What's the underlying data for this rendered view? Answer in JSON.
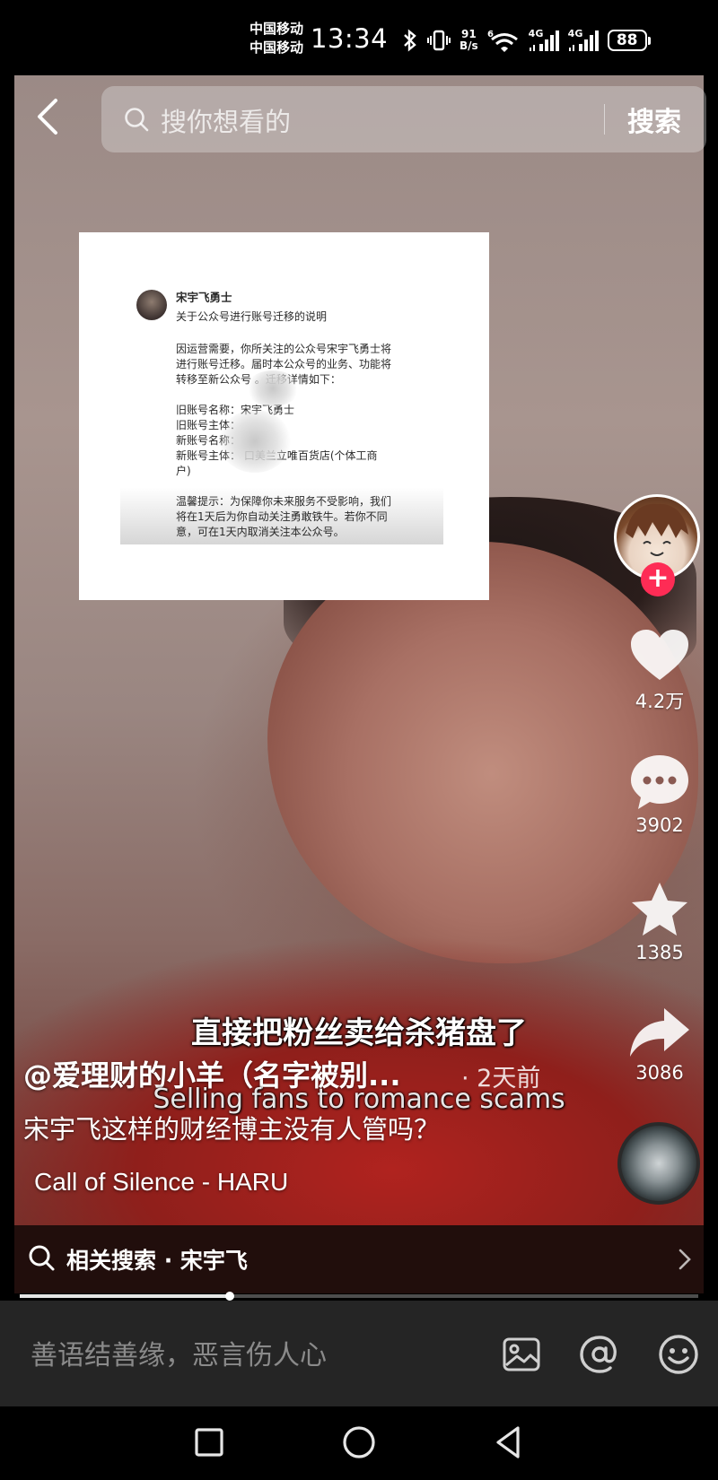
{
  "status_bar": {
    "carrier_1": "中国移动",
    "carrier_2": "中国移动",
    "time": "13:34",
    "net_speed_value": "91",
    "net_speed_unit": "B/s",
    "signal_1": "4G",
    "signal_2": "4G",
    "battery": "88"
  },
  "search": {
    "placeholder": "搜你想看的",
    "button_label": "搜索"
  },
  "document": {
    "account_name": "宋宇飞勇士",
    "title": "关于公众号进行账号迁移的说明",
    "body_lines": [
      "因运营需要，你所关注的公众号宋宇飞勇士将",
      "进行账号迁移。届时本公众号的业务、功能将",
      "转移至新公众号        。迁移详情如下：",
      "",
      "旧账号名称：宋宇飞勇士",
      "旧账号主体：",
      "新账号名称：",
      "新账号主体：    口美兰立唯百货店(个体工商",
      "户)",
      "",
      "温馨提示：为保障你未来服务不受影响，我们",
      "将在1天后为你自动关注勇敢铁牛。若你不同",
      "意，可在1天内取消关注本公众号。"
    ]
  },
  "rail": {
    "likes": "4.2万",
    "comments": "3902",
    "favorites": "1385",
    "shares": "3086"
  },
  "video": {
    "caption_cn": "直接把粉丝卖给杀猪盘了",
    "caption_en": "Selling fans to romance scams",
    "author": "@爱理财的小羊（名字被别...",
    "post_time": "· 2天前",
    "description": "宋宇飞这样的财经博主没有人管吗？",
    "music": "Call of Silence - HARU",
    "progress": 0.31
  },
  "related": {
    "label": "相关搜索 · 宋宇飞"
  },
  "comment": {
    "placeholder": "善语结善缘，恶言伤人心"
  },
  "colors": {
    "accent": "#fe2c55",
    "comment_bar_bg": "#252525"
  }
}
